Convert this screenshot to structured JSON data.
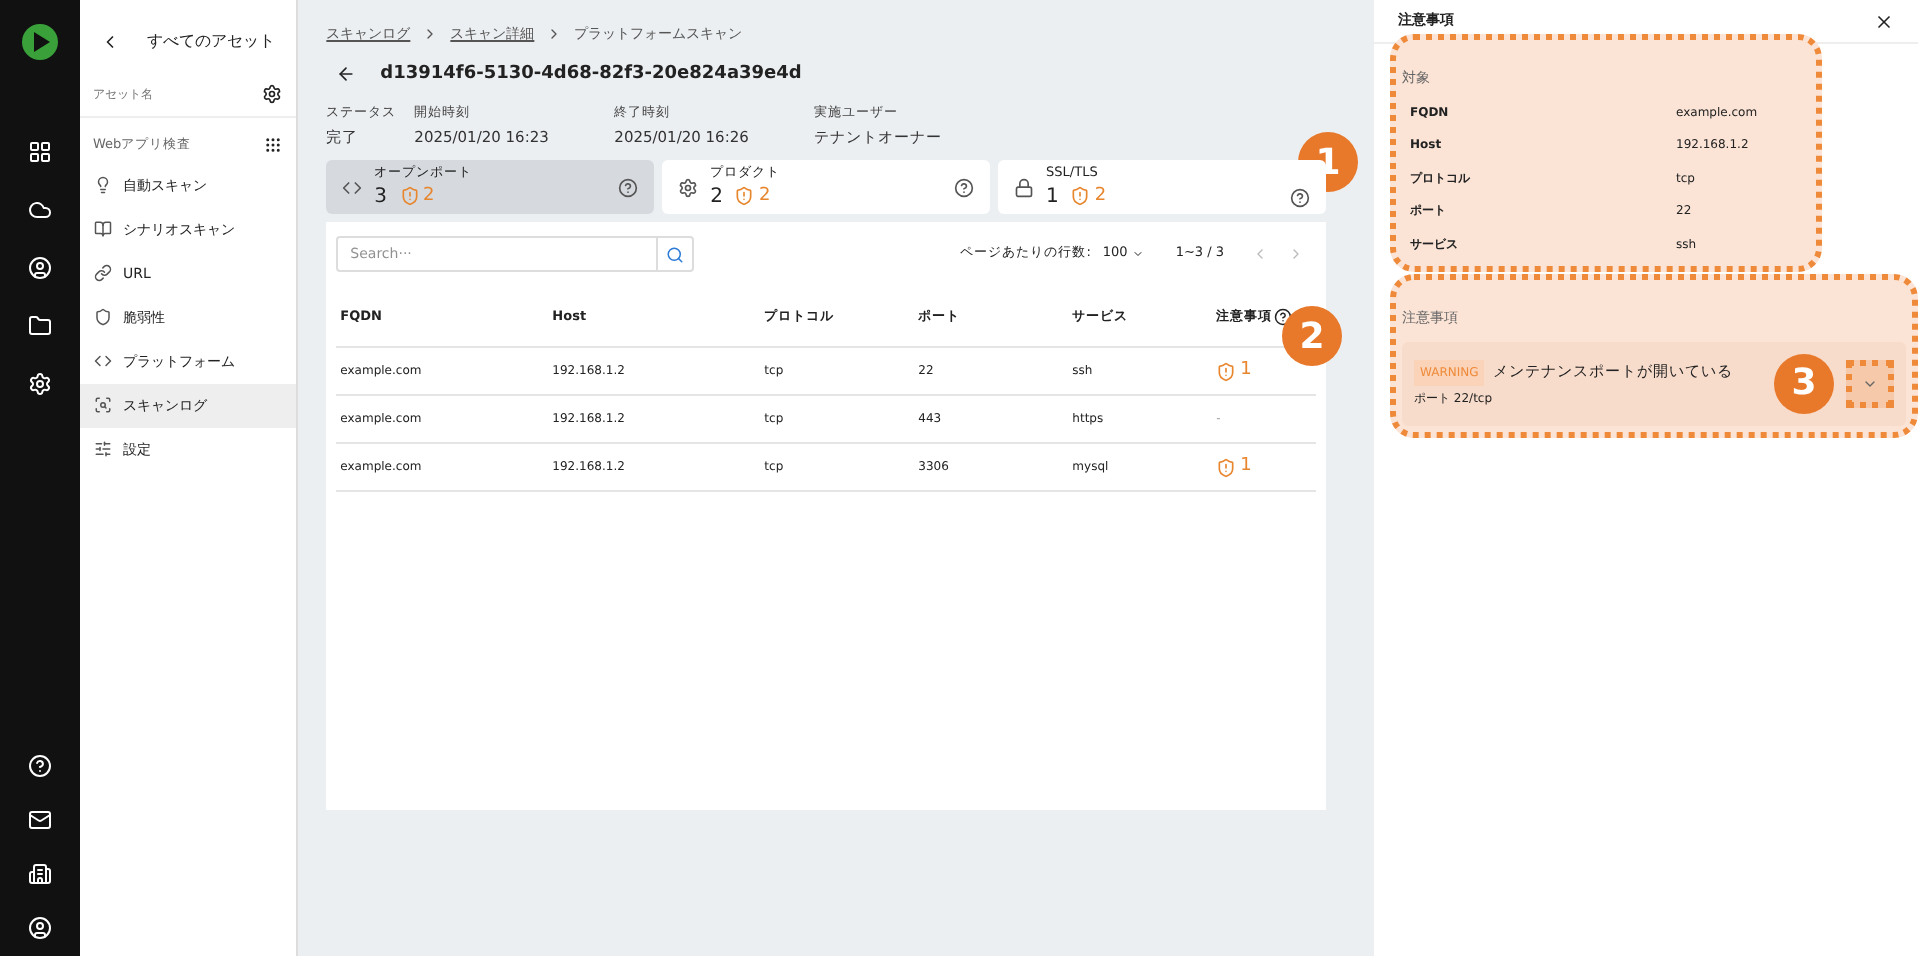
{
  "sidebar": {
    "back_label": "すべてのアセット",
    "asset_label": "アセット名",
    "section_label": "Webアプリ検査",
    "items": [
      {
        "label": "自動スキャン",
        "selected": false
      },
      {
        "label": "シナリオスキャン",
        "selected": false
      },
      {
        "label": "URL",
        "selected": false
      },
      {
        "label": "脆弱性",
        "selected": false
      },
      {
        "label": "プラットフォーム",
        "selected": false
      },
      {
        "label": "スキャンログ",
        "selected": true
      },
      {
        "label": "設定",
        "selected": false
      }
    ]
  },
  "breadcrumb": [
    "スキャンログ",
    "スキャン詳細",
    "プラットフォームスキャン"
  ],
  "title": "d13914f6-5130-4d68-82f3-20e824a39e4d",
  "meta": [
    {
      "label": "ステータス",
      "value": "完了"
    },
    {
      "label": "開始時刻",
      "value": "2025/01/20 16:23"
    },
    {
      "label": "終了時刻",
      "value": "2025/01/20 16:26"
    },
    {
      "label": "実施ユーザー",
      "value": "テナントオーナー"
    }
  ],
  "summary_cards": [
    {
      "label": "オープンポート",
      "count": "3",
      "warnings": "2",
      "selected": true
    },
    {
      "label": "プロダクト",
      "count": "2",
      "warnings": "2",
      "selected": false
    },
    {
      "label": "SSL/TLS",
      "count": "1",
      "warnings": "2",
      "selected": false
    }
  ],
  "table": {
    "search_placeholder": "Search···",
    "rows_per_page_label": "ページあたりの行数:",
    "rows_per_page": "100",
    "range": "1~3 / 3",
    "columns": [
      "FQDN",
      "Host",
      "プロトコル",
      "ポート",
      "サービス",
      "注意事項"
    ],
    "rows": [
      [
        "example.com",
        "192.168.1.2",
        "tcp",
        "22",
        "ssh",
        {
          "warnings": "1"
        }
      ],
      [
        "example.com",
        "192.168.1.2",
        "tcp",
        "443",
        "https",
        {
          "text": "-"
        }
      ],
      [
        "example.com",
        "192.168.1.2",
        "tcp",
        "3306",
        "mysql",
        {
          "warnings": "1"
        }
      ]
    ]
  },
  "detail_panel": {
    "title": "注意事項",
    "target_heading": "対象",
    "target_fields": [
      {
        "label": "FQDN",
        "value": "example.com"
      },
      {
        "label": "Host",
        "value": "192.168.1.2"
      },
      {
        "label": "プロトコル",
        "value": "tcp"
      },
      {
        "label": "ポート",
        "value": "22"
      },
      {
        "label": "サービス",
        "value": "ssh"
      }
    ],
    "notes_heading": "注意事項",
    "notes": [
      {
        "severity": "WARNING",
        "message": "メンテナンスポートが開いている",
        "detail": "ポート 22/tcp",
        "expanded": false
      }
    ]
  },
  "callouts": [
    "1",
    "2",
    "3"
  ]
}
